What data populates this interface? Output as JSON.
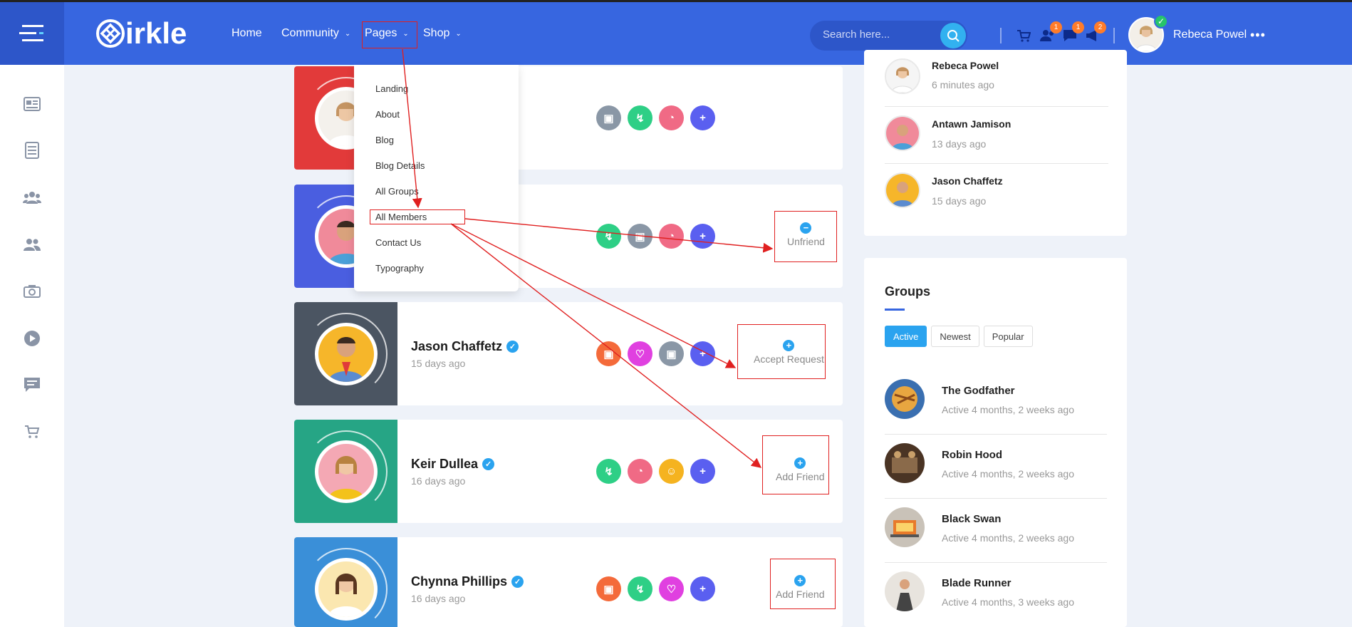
{
  "header": {
    "logo_text": "irkle",
    "nav": [
      {
        "label": "Home"
      },
      {
        "label": "Community"
      },
      {
        "label": "Pages"
      },
      {
        "label": "Shop"
      }
    ],
    "search_placeholder": "Search here...",
    "badges": {
      "friends": "1",
      "messages": "1",
      "notifications": "2"
    },
    "user_name": "Rebeca Powel"
  },
  "pages_menu": {
    "items": [
      "Landing",
      "About",
      "Blog",
      "Blog Details",
      "All Groups",
      "All Members",
      "Contact Us",
      "Typography"
    ],
    "highlighted": "All Members"
  },
  "members": [
    {
      "name": "",
      "time": "",
      "action": "",
      "cover": "#e23a3a"
    },
    {
      "name": "",
      "time": "",
      "action": "Unfriend",
      "action_icon": "−",
      "cover": "#4a5ee0"
    },
    {
      "name": "Jason Chaffetz",
      "time": "15 days ago",
      "action": "Accept Request",
      "action_icon": "+",
      "cover": "#4b5562"
    },
    {
      "name": "Keir Dullea",
      "time": "16 days ago",
      "action": "Add Friend",
      "action_icon": "+",
      "cover": "#26a585"
    },
    {
      "name": "Chynna Phillips",
      "time": "16 days ago",
      "action": "Add Friend",
      "action_icon": "+",
      "cover": "#3a8fd8"
    }
  ],
  "recent_members": [
    {
      "name": "Rebeca Powel",
      "time": "6 minutes ago"
    },
    {
      "name": "Antawn Jamison",
      "time": "13 days ago"
    },
    {
      "name": "Jason Chaffetz",
      "time": "15 days ago"
    }
  ],
  "groups": {
    "title": "Groups",
    "tabs": [
      "Active",
      "Newest",
      "Popular"
    ],
    "active_tab": "Active",
    "items": [
      {
        "name": "The Godfather",
        "time": "Active 4 months, 2 weeks ago"
      },
      {
        "name": "Robin Hood",
        "time": "Active 4 months, 2 weeks ago"
      },
      {
        "name": "Black Swan",
        "time": "Active 4 months, 2 weeks ago"
      },
      {
        "name": "Blade Runner",
        "time": "Active 4 months, 3 weeks ago"
      }
    ]
  },
  "colors": {
    "primary": "#3766e0",
    "primary_dark": "#2d56c9",
    "accent": "#2aa3ef",
    "badge": "#ff7c2a",
    "annotation": "#e02020"
  }
}
